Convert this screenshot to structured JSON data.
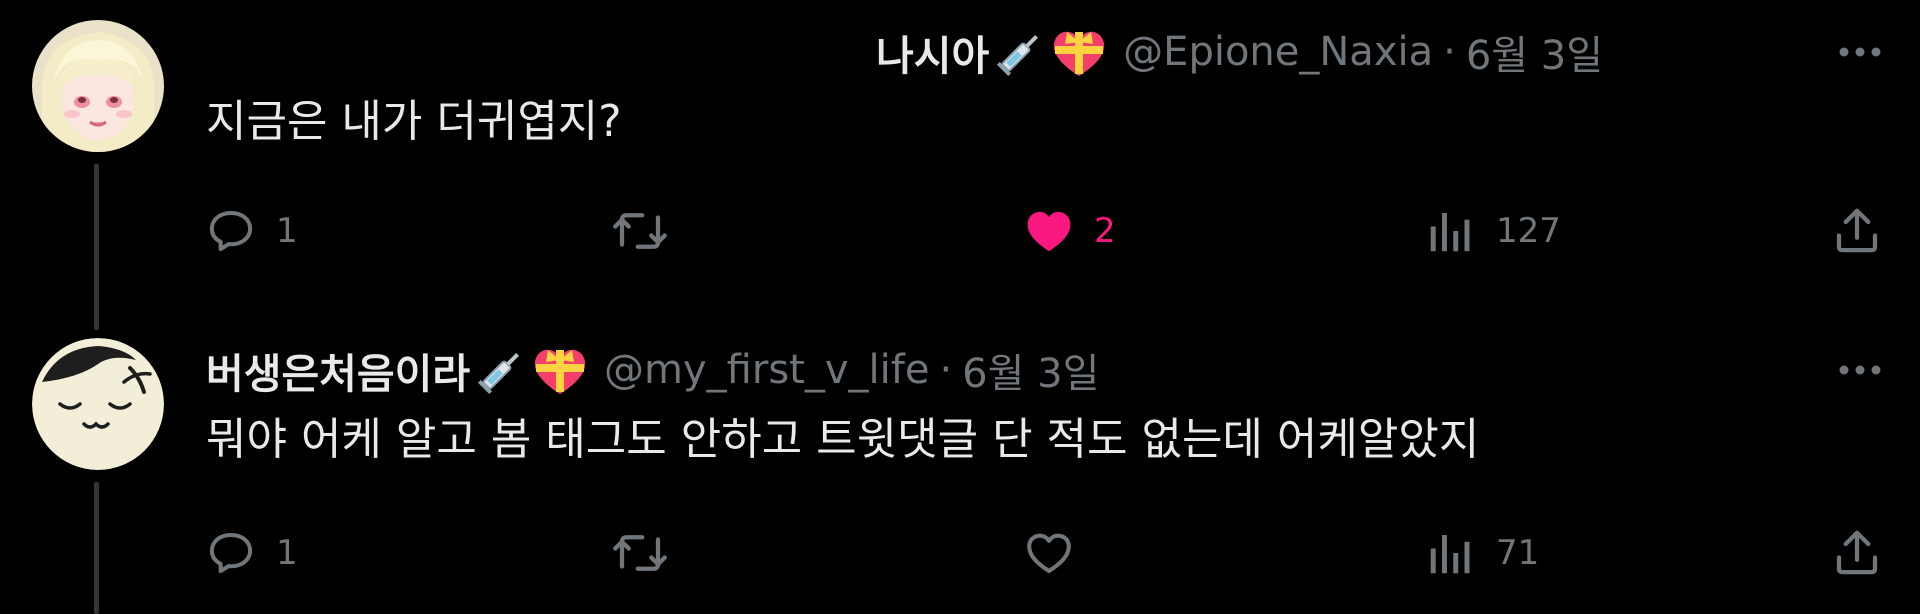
{
  "tweets": [
    {
      "display_name": "나시아",
      "badges": [
        "syringe-icon",
        "heart-gift-icon"
      ],
      "handle": "@Epione_Naxia",
      "separator": "·",
      "date": "6월 3일",
      "text": "지금은 내가 더귀엽지?",
      "avatar": "anime-avatar",
      "metrics": {
        "replies": "1",
        "retweets": "",
        "likes": "2",
        "views": "127"
      },
      "liked": true
    },
    {
      "display_name": "버생은처음이라",
      "badges": [
        "syringe-icon",
        "heart-gift-icon"
      ],
      "handle": "@my_first_v_life",
      "separator": "·",
      "date": "6월 3일",
      "text": "뭐야 어케 알고 봄 태그도 안하고 트윗댓글 단 적도 없는데 어케알았지",
      "avatar": "sleepy-face-avatar",
      "metrics": {
        "replies": "1",
        "retweets": "",
        "likes": "",
        "views": "71"
      },
      "liked": false
    }
  ],
  "colors": {
    "background": "#000000",
    "text": "#e7e9ea",
    "muted": "#71767b",
    "like": "#f91880",
    "thread_line": "#333639"
  }
}
